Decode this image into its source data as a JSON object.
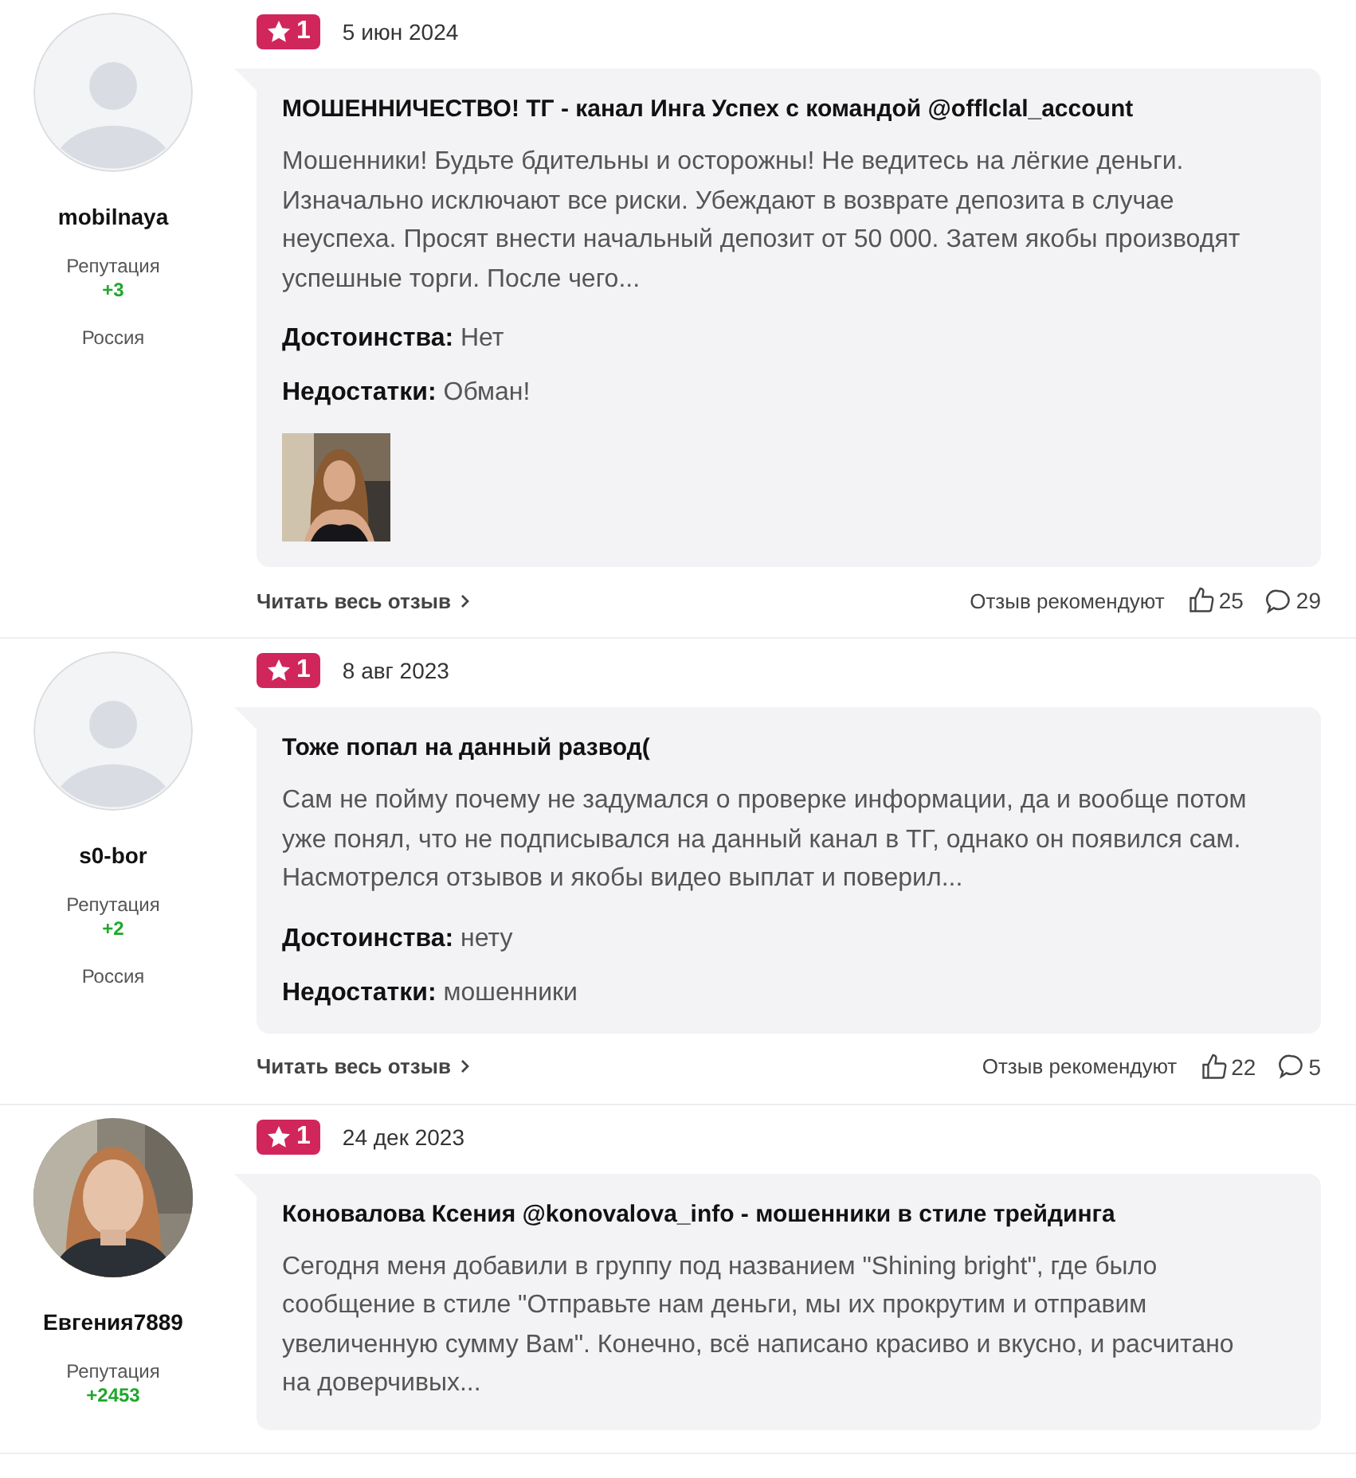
{
  "reviews": [
    {
      "user": {
        "name": "mobilnaya",
        "reputation_label": "Репутация",
        "reputation": "+3",
        "country": "Россия"
      },
      "rating": "1",
      "date": "5 июн 2024",
      "title": "МОШЕННИЧЕСТВО! ТГ - канал Инга Успех с командой @offlclal_account",
      "text": "Мошенники! Будьте бдительны и осторожны! Не ведитесь на лёгкие деньги. Изначально исключают все риски. Убеждают в возврате депозита в случае неуспеха. Просят внести начальный депозит от 50 000. Затем якобы производят успешные торги. После чего...",
      "pros": "**Достоинства:** Нет",
      "cons": "**Недостатки:** Обман!",
      "read_more": "Читать весь отзыв",
      "recommend": "Отзыв рекомендуют",
      "likes": "25",
      "comments": "29"
    },
    {
      "user": {
        "name": "s0-bor",
        "reputation_label": "Репутация",
        "reputation": "+2",
        "country": "Россия"
      },
      "rating": "1",
      "date": "8 авг 2023",
      "title": "Тоже попал на данный развод(",
      "text": "Сам не пойму почему не задумался о проверке информации, да и вообще потом уже понял, что не подписывался на данный канал в ТГ, однако он появился сам. Насмотрелся отзывов и якобы видео выплат и поверил...",
      "pros": "**Достоинства:** нету",
      "cons": "**Недостатки:** мошенники",
      "read_more": "Читать весь отзыв",
      "recommend": "Отзыв рекомендуют",
      "likes": "22",
      "comments": "5"
    },
    {
      "user": {
        "name": "Евгения7889",
        "reputation_label": "Репутация",
        "reputation": "+2453"
      },
      "rating": "1",
      "date": "24 дек 2023",
      "title": "Коновалова Ксения @konovalova_info - мошенники в стиле трейдинга",
      "text": "Сегодня меня добавили в группу под названием \"Shining bright\", где было сообщение в стиле \"Отправьте нам деньги, мы их прокрутим и отправим увеличенную сумму Вам\". Конечно, всё написано красиво и вкусно, и расчитано на доверчивых..."
    }
  ]
}
